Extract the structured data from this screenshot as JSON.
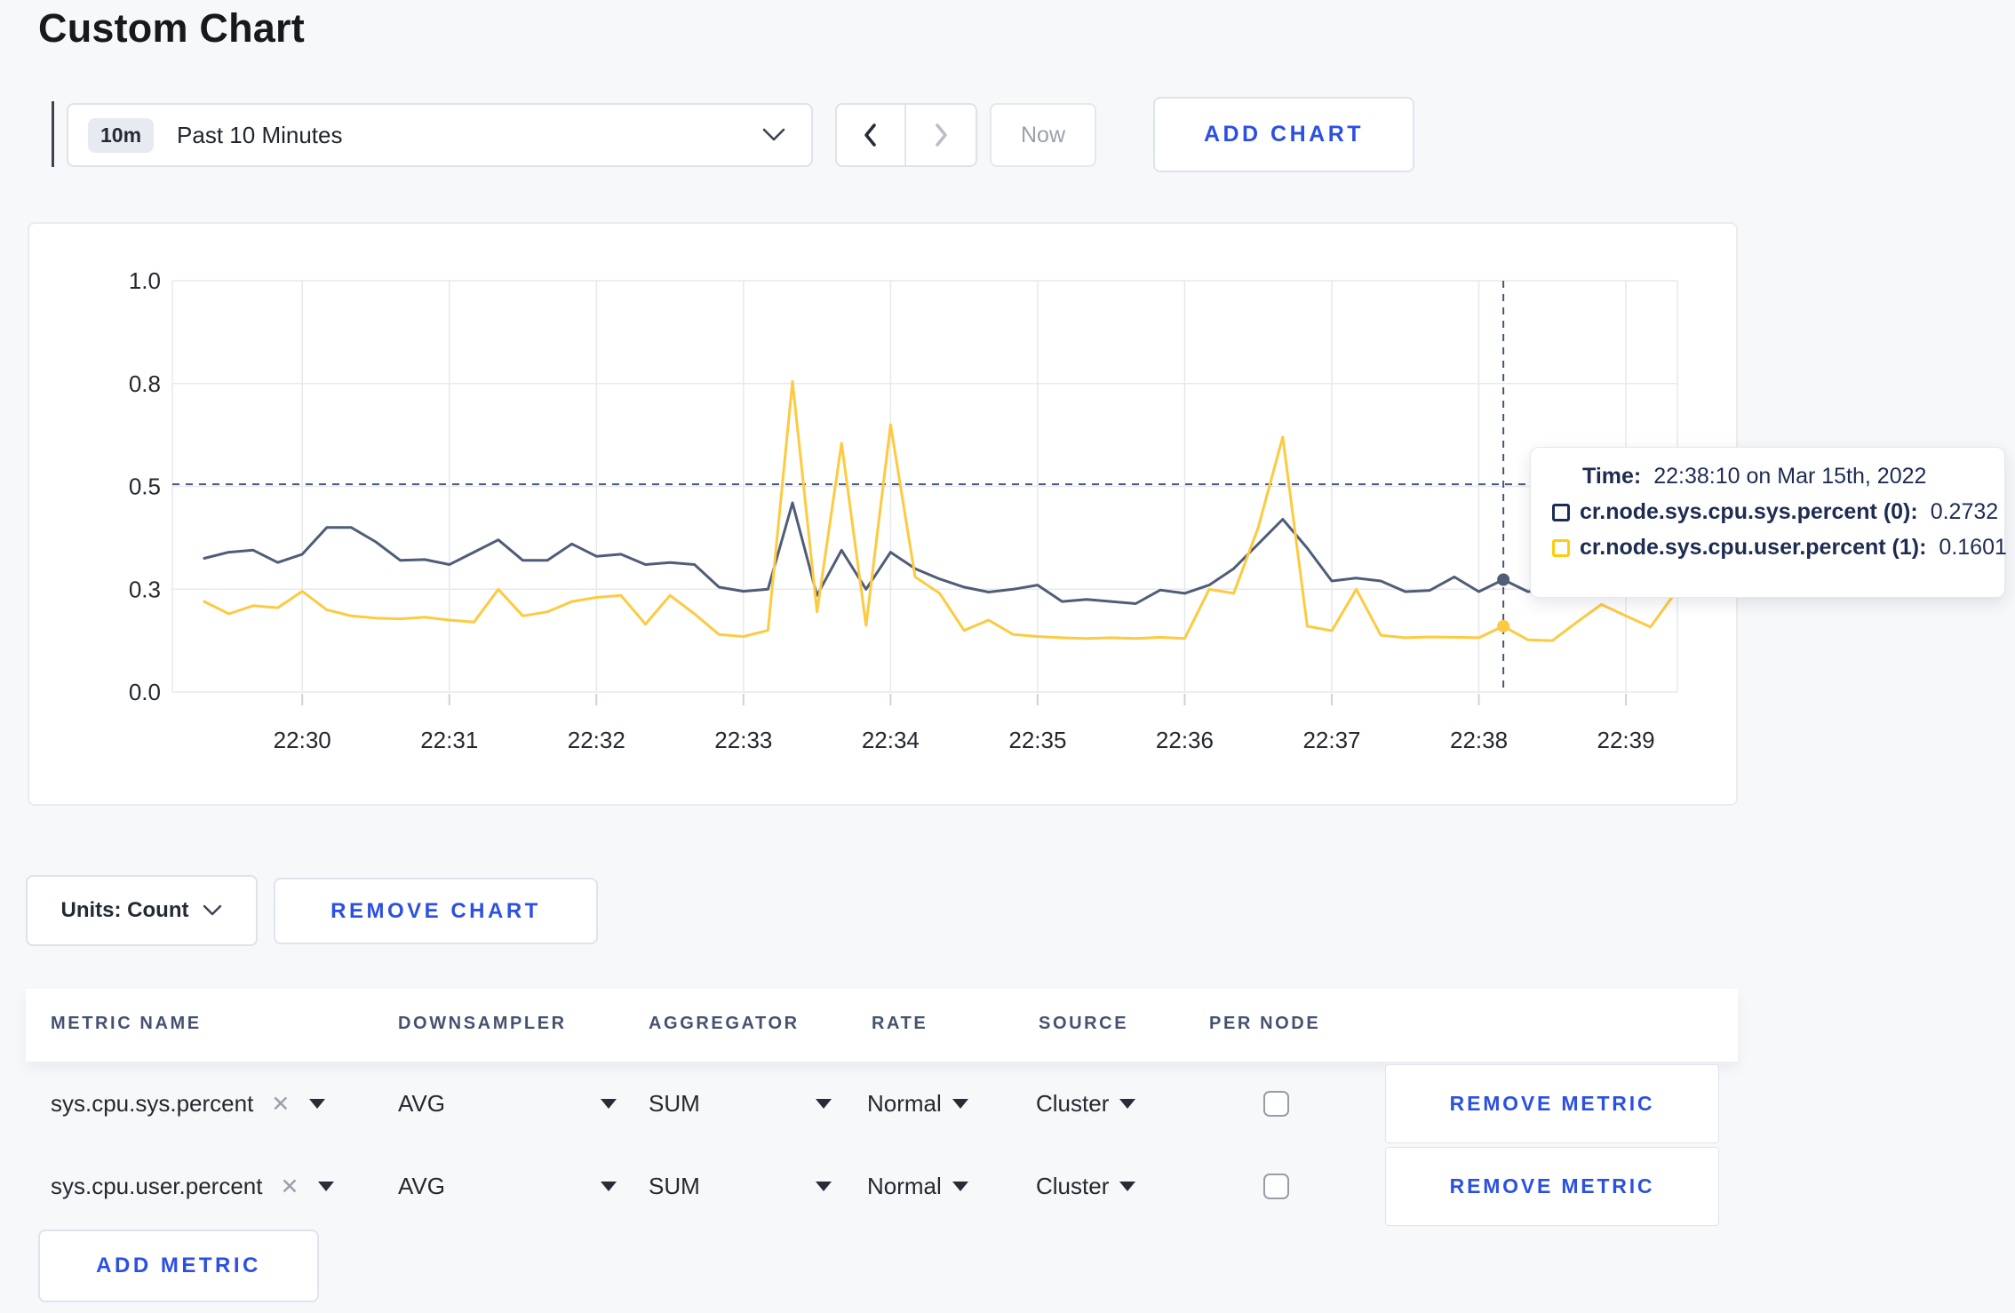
{
  "page": {
    "title": "Custom Chart"
  },
  "colors": {
    "accent_blue": "#2b50e2",
    "series_sys": "#4f5d78",
    "series_user": "#fdca40",
    "tooltip_navy": "#1e2c52",
    "swatch_yellow": "#ffcd05"
  },
  "toolbar": {
    "time_badge": "10m",
    "time_label": "Past 10 Minutes",
    "now_label": "Now",
    "add_chart_label": "ADD CHART"
  },
  "chart_data": {
    "type": "line",
    "title": "",
    "xlabel": "",
    "ylabel": "",
    "ylim": [
      0,
      1
    ],
    "grid": true,
    "legend_position": "none",
    "start_time": "22:29:20",
    "sample_interval_s": 10,
    "x_domain_offsets_s": [
      -13,
      601
    ],
    "x_ticks": [
      {
        "offset_s": 40,
        "label": "22:30"
      },
      {
        "offset_s": 100,
        "label": "22:31"
      },
      {
        "offset_s": 160,
        "label": "22:32"
      },
      {
        "offset_s": 220,
        "label": "22:33"
      },
      {
        "offset_s": 280,
        "label": "22:34"
      },
      {
        "offset_s": 340,
        "label": "22:35"
      },
      {
        "offset_s": 400,
        "label": "22:36"
      },
      {
        "offset_s": 460,
        "label": "22:37"
      },
      {
        "offset_s": 520,
        "label": "22:38"
      },
      {
        "offset_s": 580,
        "label": "22:39"
      }
    ],
    "y_ticks": [
      {
        "value": 0,
        "label": "0.0"
      },
      {
        "value": 0.25,
        "label": "0.3"
      },
      {
        "value": 0.5,
        "label": "0.5"
      },
      {
        "value": 0.75,
        "label": "0.8"
      },
      {
        "value": 1,
        "label": "1.0"
      }
    ],
    "series": [
      {
        "name": "cr.node.sys.cpu.sys.percent",
        "color": "#4f5d78",
        "values": [
          0.325,
          0.34,
          0.345,
          0.315,
          0.335,
          0.4,
          0.4,
          0.365,
          0.32,
          0.322,
          0.31,
          0.34,
          0.37,
          0.32,
          0.32,
          0.36,
          0.33,
          0.335,
          0.31,
          0.315,
          0.31,
          0.255,
          0.245,
          0.25,
          0.46,
          0.235,
          0.345,
          0.25,
          0.34,
          0.3,
          0.275,
          0.255,
          0.243,
          0.25,
          0.26,
          0.22,
          0.225,
          0.22,
          0.215,
          0.248,
          0.24,
          0.26,
          0.3,
          0.36,
          0.42,
          0.35,
          0.27,
          0.277,
          0.27,
          0.244,
          0.247,
          0.28,
          0.244,
          0.2732,
          0.244,
          0.25,
          0.26,
          0.27,
          0.285,
          0.295,
          0.3
        ]
      },
      {
        "name": "cr.node.sys.cpu.user.percent",
        "color": "#fdca40",
        "values": [
          0.22,
          0.19,
          0.21,
          0.205,
          0.245,
          0.2,
          0.185,
          0.18,
          0.178,
          0.182,
          0.175,
          0.17,
          0.25,
          0.185,
          0.195,
          0.22,
          0.23,
          0.235,
          0.165,
          0.235,
          0.19,
          0.14,
          0.135,
          0.15,
          0.755,
          0.195,
          0.605,
          0.162,
          0.65,
          0.28,
          0.24,
          0.15,
          0.175,
          0.14,
          0.135,
          0.132,
          0.13,
          0.132,
          0.13,
          0.133,
          0.13,
          0.25,
          0.24,
          0.4,
          0.62,
          0.16,
          0.149,
          0.25,
          0.138,
          0.132,
          0.134,
          0.133,
          0.132,
          0.1601,
          0.127,
          0.125,
          0.17,
          0.213,
          0.185,
          0.158,
          0.24
        ]
      }
    ],
    "crosshair": {
      "time_offset_s": 530,
      "hline_value": 0.505
    }
  },
  "tooltip": {
    "time_label": "Time:",
    "time_value": "22:38:10 on Mar 15th, 2022",
    "rows": [
      {
        "label": "cr.node.sys.cpu.sys.percent (0):",
        "value": "0.2732",
        "swatch_color": "#1c2c55"
      },
      {
        "label": "cr.node.sys.cpu.user.percent (1):",
        "value": "0.1601",
        "swatch_color": "#ffcd05"
      }
    ]
  },
  "units_row": {
    "units_label": "Units: Count",
    "remove_chart_label": "REMOVE CHART"
  },
  "metrics_table": {
    "headers": {
      "metric_name": "METRIC NAME",
      "downsampler": "DOWNSAMPLER",
      "aggregator": "AGGREGATOR",
      "rate": "RATE",
      "source": "SOURCE",
      "per_node": "PER NODE"
    },
    "rows": [
      {
        "metric": "sys.cpu.sys.percent",
        "clear_icon": "✕",
        "downsampler": "AVG",
        "aggregator": "SUM",
        "rate": "Normal",
        "source": "Cluster",
        "per_node_checked": false,
        "remove_label": "REMOVE METRIC"
      },
      {
        "metric": "sys.cpu.user.percent",
        "clear_icon": "✕",
        "downsampler": "AVG",
        "aggregator": "SUM",
        "rate": "Normal",
        "source": "Cluster",
        "per_node_checked": false,
        "remove_label": "REMOVE METRIC"
      }
    ],
    "add_metric_label": "ADD METRIC"
  }
}
